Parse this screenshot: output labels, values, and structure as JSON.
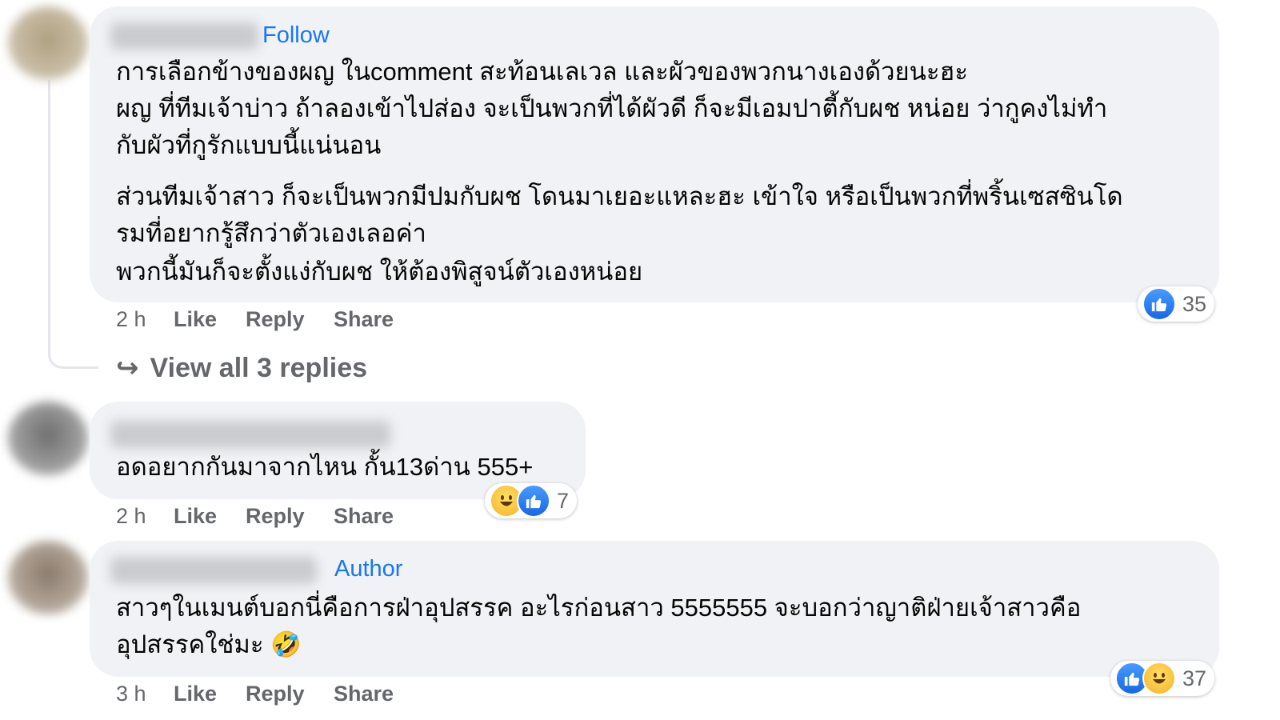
{
  "comments": [
    {
      "tag": "Follow",
      "lines": [
        "การเลือกข้างของผญ ในcomment สะท้อนเลเวล และผัวของพวกนางเองด้วยนะฮะ",
        "ผญ ที่ทีมเจ้าบ่าว ถ้าลองเข้าไปส่อง จะเป็นพวกที่ได้ผัวดี ก็จะมีเอมปาตี้กับผช หน่อย ว่ากูคงไม่ทำ",
        "กับผัวที่กูรักแบบนี้แน่นอน",
        "ส่วนทีมเจ้าสาว ก็จะเป็นพวกมีปมกับผช โดนมาเยอะแหละฮะ เข้าใจ หรือเป็นพวกที่พริ้นเซสซินโด",
        "รมที่อยากรู้สึกว่าตัวเองเลอค่า",
        "พวกนี้มันก็จะตั้งแง่กับผช ให้ต้องพิสูจน์ตัวเองหน่อย"
      ],
      "time": "2 h",
      "like_label": "Like",
      "reply_label": "Reply",
      "share_label": "Share",
      "reaction_count": "35",
      "reactions": [
        "like"
      ]
    },
    {
      "tag": "",
      "lines": [
        "อดอยากกันมาจากไหน กั้น13ด่าน 555+"
      ],
      "time": "2 h",
      "like_label": "Like",
      "reply_label": "Reply",
      "share_label": "Share",
      "reaction_count": "7",
      "reactions": [
        "haha",
        "like"
      ]
    },
    {
      "tag": "Author",
      "lines": [
        "สาวๆในเมนต์บอกนี่คือการฝ่าอุปสรรค อะไรก่อนสาว 5555555 จะบอกว่าญาติฝ่ายเจ้าสาวคือ",
        "อุปสรรคใช่มะ 🤣"
      ],
      "time": "3 h",
      "like_label": "Like",
      "reply_label": "Reply",
      "share_label": "Share",
      "reaction_count": "37",
      "reactions": [
        "like",
        "haha"
      ]
    }
  ],
  "view_replies": {
    "arrow": "↪",
    "label": "View all 3 replies"
  },
  "colors": {
    "bubble": "#f0f2f5",
    "link": "#1877f2",
    "muted": "#65676b",
    "text": "#050505"
  }
}
